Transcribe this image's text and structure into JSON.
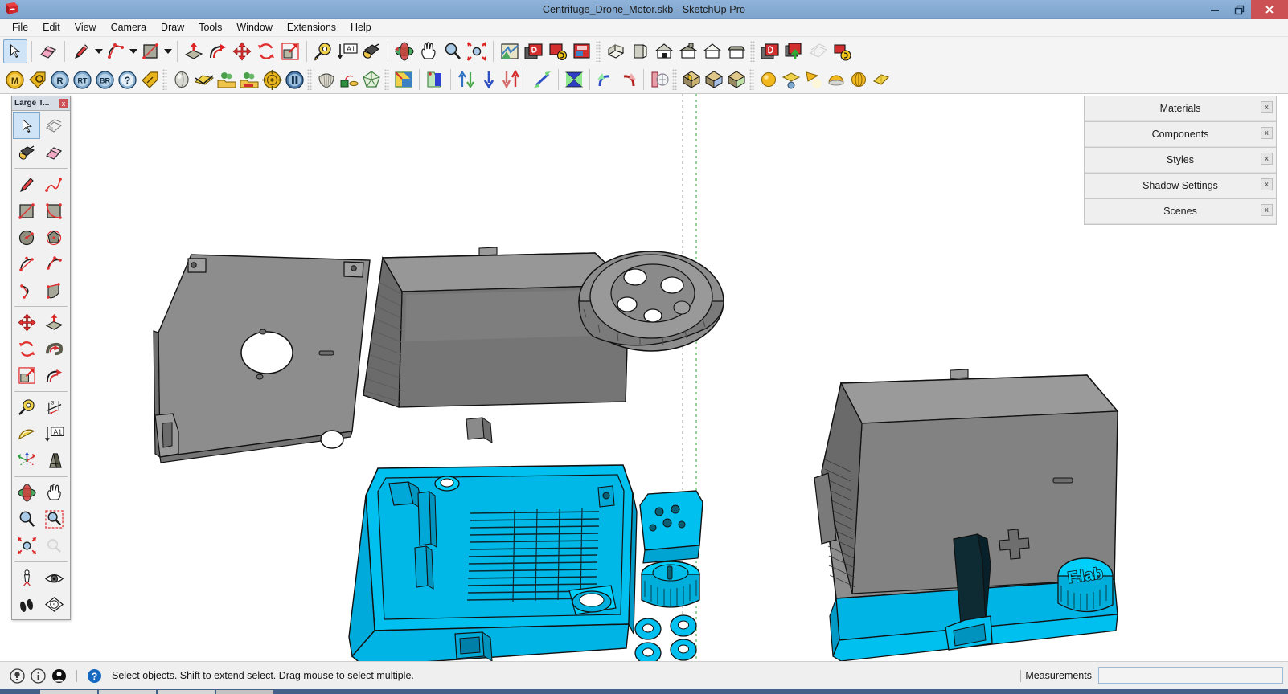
{
  "window": {
    "title": "Centrifuge_Drone_Motor.skb - SketchUp Pro",
    "logo_icon": "sketchup-logo-icon",
    "controls": [
      {
        "name": "minimize-button",
        "icon": "minimize-icon",
        "label": "–"
      },
      {
        "name": "restore-button",
        "icon": "restore-icon",
        "label": "❐"
      },
      {
        "name": "close-button",
        "icon": "close-icon",
        "label": "✕"
      }
    ],
    "titlebar_color": "#8fb3d9",
    "close_color": "#cb5155"
  },
  "menubar": {
    "items": [
      {
        "label": "File"
      },
      {
        "label": "Edit"
      },
      {
        "label": "View"
      },
      {
        "label": "Camera"
      },
      {
        "label": "Draw"
      },
      {
        "label": "Tools"
      },
      {
        "label": "Window"
      },
      {
        "label": "Extensions"
      },
      {
        "label": "Help"
      }
    ]
  },
  "toolbar_row1": {
    "groups": [
      {
        "name": "principal-tools",
        "buttons": [
          {
            "name": "select-tool",
            "icon": "arrow-cursor-icon",
            "active": true
          },
          {
            "name": "eraser-tool",
            "icon": "eraser-icon",
            "active": false
          }
        ]
      },
      {
        "name": "drawing-tools",
        "buttons": [
          {
            "name": "line-tool",
            "icon": "pencil-icon",
            "dropdown": true
          },
          {
            "name": "arc-tool",
            "icon": "arc-icon",
            "dropdown": true
          },
          {
            "name": "shapes-tool",
            "icon": "rectangle-icon",
            "dropdown": true
          }
        ]
      },
      {
        "name": "modification-tools",
        "buttons": [
          {
            "name": "pushpull-tool",
            "icon": "push-pull-icon"
          },
          {
            "name": "followme-tool",
            "icon": "follow-me-icon"
          },
          {
            "name": "move-tool",
            "icon": "move-arrows-icon"
          },
          {
            "name": "rotate-tool",
            "icon": "rotate-icon"
          },
          {
            "name": "scale-tool",
            "icon": "scale-icon"
          }
        ]
      },
      {
        "name": "construction-tools",
        "buttons": [
          {
            "name": "tape-measure-tool",
            "icon": "tape-measure-icon"
          },
          {
            "name": "text-tool",
            "icon": "text-a1-icon"
          },
          {
            "name": "paint-bucket-tool",
            "icon": "paint-bucket-icon"
          }
        ]
      },
      {
        "name": "camera-tools",
        "buttons": [
          {
            "name": "orbit-tool",
            "icon": "orbit-icon"
          },
          {
            "name": "pan-tool",
            "icon": "hand-pan-icon"
          },
          {
            "name": "zoom-tool",
            "icon": "magnifier-icon"
          },
          {
            "name": "zoom-extents-tool",
            "icon": "zoom-extents-icon"
          }
        ]
      },
      {
        "name": "google-tools",
        "buttons": [
          {
            "name": "add-location-tool",
            "icon": "map-location-icon"
          },
          {
            "name": "get-models-tool",
            "icon": "warehouse-model-icon"
          },
          {
            "name": "share-model-tool",
            "icon": "warehouse-share-icon"
          },
          {
            "name": "photo-textures-tool",
            "icon": "photo-texture-icon"
          }
        ]
      },
      {
        "name": "standard-views",
        "buttons": [
          {
            "name": "view-iso",
            "icon": "house-iso-icon"
          },
          {
            "name": "view-back",
            "icon": "house-back-icon"
          },
          {
            "name": "view-front",
            "icon": "house-front-icon"
          },
          {
            "name": "view-top",
            "icon": "house-top-icon"
          },
          {
            "name": "view-right",
            "icon": "house-right-icon"
          },
          {
            "name": "view-left",
            "icon": "house-left-icon"
          }
        ]
      },
      {
        "name": "warehouse-tools",
        "buttons": [
          {
            "name": "warehouse-browse",
            "icon": "warehouse-browse-icon"
          },
          {
            "name": "warehouse-upload",
            "icon": "warehouse-upload-icon"
          },
          {
            "name": "layers-manager",
            "icon": "layers-stack-icon",
            "disabled": true
          },
          {
            "name": "extension-warehouse",
            "icon": "extension-warehouse-icon"
          }
        ]
      }
    ]
  },
  "toolbar_row2": {
    "groups": [
      {
        "name": "extension-badges",
        "buttons": [
          {
            "name": "material-tool",
            "icon": "badge-m-icon",
            "text": "M"
          },
          {
            "name": "object-tag-tool",
            "icon": "tag-o-icon",
            "text": ""
          },
          {
            "name": "render-tool",
            "icon": "badge-r-icon",
            "text": "R"
          },
          {
            "name": "render-tools",
            "icon": "badge-rt-icon",
            "text": "RT"
          },
          {
            "name": "batch-render-tool",
            "icon": "badge-br-icon",
            "text": "BR"
          },
          {
            "name": "help-badge",
            "icon": "badge-question-icon",
            "text": "?"
          },
          {
            "name": "tag-tool",
            "icon": "tag-gold-icon",
            "text": ""
          }
        ]
      },
      {
        "name": "render-objects",
        "buttons": [
          {
            "name": "sphere-object",
            "icon": "sphere-grey-icon"
          },
          {
            "name": "intersect-tool",
            "icon": "intersect-icon"
          },
          {
            "name": "proxy-library-open",
            "icon": "tree-folder-icon"
          },
          {
            "name": "proxy-library-save",
            "icon": "tree-folder-save-icon"
          },
          {
            "name": "target-tool",
            "icon": "target-icon"
          },
          {
            "name": "pause-render",
            "icon": "pause-icon"
          }
        ]
      },
      {
        "name": "shape-generators",
        "buttons": [
          {
            "name": "mesh-shell",
            "icon": "mesh-shell-icon"
          },
          {
            "name": "pendulum-tool",
            "icon": "pendulum-icon"
          },
          {
            "name": "polyhedron-tool",
            "icon": "polyhedron-icon"
          }
        ]
      },
      {
        "name": "face-tools",
        "buttons": [
          {
            "name": "face-color-tool",
            "icon": "face-color-icon"
          },
          {
            "name": "face-extract-tool",
            "icon": "face-extract-icon"
          },
          {
            "name": "flip-vertical-tool",
            "icon": "flip-vertical-icon"
          },
          {
            "name": "push-down-tool",
            "icon": "arrow-down-blue-icon"
          },
          {
            "name": "pull-up-tool",
            "icon": "arrow-up-red-icon"
          }
        ]
      },
      {
        "name": "edge-tools",
        "buttons": [
          {
            "name": "edge-diagonal-tool",
            "icon": "edge-diagonal-icon"
          },
          {
            "name": "bowtie-tool",
            "icon": "bowtie-icon"
          }
        ]
      },
      {
        "name": "rotation-tools",
        "buttons": [
          {
            "name": "rotate-ccw-tool",
            "icon": "rotate-ccw-blue-icon"
          },
          {
            "name": "rotate-cw-tool",
            "icon": "rotate-cw-red-icon"
          },
          {
            "name": "mirror-tool",
            "icon": "mirror-icon"
          }
        ]
      },
      {
        "name": "solid-tools",
        "buttons": [
          {
            "name": "solid-union",
            "icon": "solid-union-icon"
          },
          {
            "name": "solid-subtract",
            "icon": "solid-subtract-icon"
          },
          {
            "name": "solid-split",
            "icon": "solid-split-icon"
          }
        ]
      },
      {
        "name": "light-tools",
        "buttons": [
          {
            "name": "omni-light",
            "icon": "omni-light-icon"
          },
          {
            "name": "area-light",
            "icon": "area-light-icon"
          },
          {
            "name": "spot-light",
            "icon": "spot-light-icon"
          },
          {
            "name": "dome-light",
            "icon": "dome-light-icon"
          },
          {
            "name": "ies-light",
            "icon": "ies-light-icon"
          },
          {
            "name": "rect-light",
            "icon": "rect-light-icon"
          }
        ]
      }
    ]
  },
  "palette": {
    "title": "Large T...",
    "close_label": "x",
    "rows": [
      [
        {
          "name": "palette-select-tool",
          "icon": "arrow-cursor-icon",
          "active": true
        },
        {
          "name": "palette-make-component-tool",
          "icon": "make-component-icon"
        }
      ],
      [
        {
          "name": "palette-paint-bucket-tool",
          "icon": "paint-bucket-icon"
        },
        {
          "name": "palette-eraser-tool",
          "icon": "eraser-icon"
        }
      ],
      "divider",
      [
        {
          "name": "palette-line-tool",
          "icon": "pencil-icon"
        },
        {
          "name": "palette-freehand-tool",
          "icon": "freehand-icon"
        }
      ],
      [
        {
          "name": "palette-rectangle-tool",
          "icon": "rectangle-icon"
        },
        {
          "name": "palette-rotated-rectangle-tool",
          "icon": "rotated-rectangle-icon"
        }
      ],
      [
        {
          "name": "palette-circle-tool",
          "icon": "circle-icon"
        },
        {
          "name": "palette-polygon-tool",
          "icon": "polygon-icon"
        }
      ],
      [
        {
          "name": "palette-arc-tool",
          "icon": "arc-2point-icon"
        },
        {
          "name": "palette-pie-tool",
          "icon": "pie-icon"
        }
      ],
      [
        {
          "name": "palette-3point-arc-tool",
          "icon": "arc-3point-icon"
        },
        {
          "name": "palette-freehand-shape-tool",
          "icon": "freehand-shape-icon"
        }
      ],
      "divider",
      [
        {
          "name": "palette-move-tool",
          "icon": "move-arrows-icon"
        },
        {
          "name": "palette-pushpull-tool",
          "icon": "push-pull-icon"
        }
      ],
      [
        {
          "name": "palette-rotate-tool",
          "icon": "rotate-icon"
        },
        {
          "name": "palette-followme-tool",
          "icon": "follow-me-curl-icon"
        }
      ],
      [
        {
          "name": "palette-scale-tool",
          "icon": "scale-icon"
        },
        {
          "name": "palette-offset-tool",
          "icon": "offset-icon"
        }
      ],
      "divider",
      [
        {
          "name": "palette-tape-measure-tool",
          "icon": "tape-measure-icon"
        },
        {
          "name": "palette-dimension-tool",
          "icon": "dimension-icon"
        }
      ],
      [
        {
          "name": "palette-protractor-tool",
          "icon": "protractor-icon"
        },
        {
          "name": "palette-text-tool",
          "icon": "text-a1-icon"
        }
      ],
      [
        {
          "name": "palette-axes-tool",
          "icon": "axes-icon"
        },
        {
          "name": "palette-3dtext-tool",
          "icon": "3d-text-icon"
        }
      ],
      "divider",
      [
        {
          "name": "palette-orbit-tool",
          "icon": "orbit-icon"
        },
        {
          "name": "palette-pan-tool",
          "icon": "hand-pan-icon"
        }
      ],
      [
        {
          "name": "palette-zoom-tool",
          "icon": "magnifier-icon"
        },
        {
          "name": "palette-zoom-window-tool",
          "icon": "zoom-window-icon"
        }
      ],
      [
        {
          "name": "palette-zoom-extents-tool",
          "icon": "zoom-extents-icon"
        },
        {
          "name": "palette-previous-view-tool",
          "icon": "previous-view-icon",
          "disabled": true
        }
      ],
      "divider",
      [
        {
          "name": "palette-position-camera-tool",
          "icon": "position-camera-icon"
        },
        {
          "name": "palette-look-around-tool",
          "icon": "eye-look-around-icon"
        }
      ],
      [
        {
          "name": "palette-walk-tool",
          "icon": "walk-footprints-icon"
        },
        {
          "name": "palette-section-plane-tool",
          "icon": "section-plane-icon"
        }
      ]
    ]
  },
  "tray": {
    "panels": [
      {
        "name": "tray-panel-materials",
        "label": "Materials",
        "close_label": "x"
      },
      {
        "name": "tray-panel-components",
        "label": "Components",
        "close_label": "x"
      },
      {
        "name": "tray-panel-styles",
        "label": "Styles",
        "close_label": "x"
      },
      {
        "name": "tray-panel-shadow-settings",
        "label": "Shadow Settings",
        "close_label": "x"
      },
      {
        "name": "tray-panel-scenes",
        "label": "Scenes",
        "close_label": "x"
      }
    ]
  },
  "statusbar": {
    "icons": [
      {
        "name": "hint-bulb-icon",
        "label": ""
      },
      {
        "name": "info-icon",
        "label": ""
      },
      {
        "name": "account-icon",
        "label": ""
      },
      {
        "name": "help-circle-icon",
        "label": ""
      }
    ],
    "hint": "Select objects. Shift to extend select. Drag mouse to select multiple.",
    "measurements_label": "Measurements",
    "measurements_value": "",
    "measurements_placeholder": ""
  },
  "viewport": {
    "model_name": "Centrifuge Drone Motor",
    "selection_color": "#00c0f0",
    "body_color": "#8a8a8a",
    "body_shade_dark": "#6f6f6f",
    "body_shade_mid": "#7d7d7d",
    "edge_color": "#111111",
    "label_on_cap": "F.lab",
    "axis_guide_color": "#9a9a9a",
    "axis_guide_green": "#31a531"
  }
}
